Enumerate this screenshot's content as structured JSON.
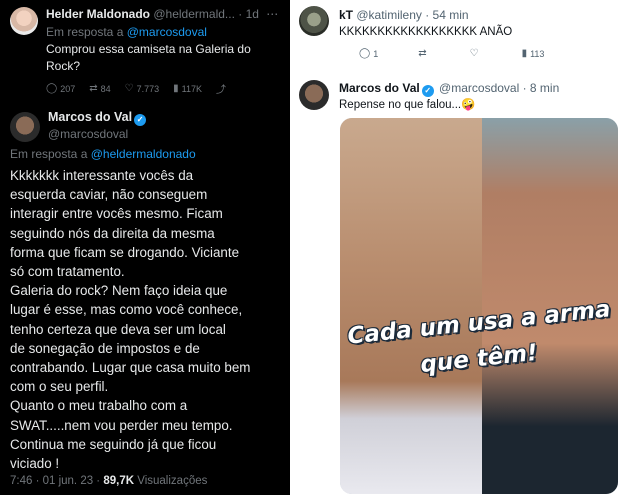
{
  "left": {
    "reply_tweet": {
      "name": "Helder Maldonado",
      "handle_time": "@heldermald... · 1d",
      "in_reply_prefix": "Em resposta a",
      "in_reply_handle": "@marcosdoval",
      "text_line1": "Comprou essa camiseta na Galeria do",
      "text_line2": "Rock?",
      "metrics": {
        "replies": "207",
        "retweets": "84",
        "likes": "7.773",
        "views": "117K"
      }
    },
    "main_tweet": {
      "name": "Marcos do Val",
      "handle": "@marcosdoval",
      "in_reply_prefix": "Em resposta a",
      "in_reply_handle": "@heldermaldonado",
      "lines": [
        "Kkkkkkk interessante vocês da",
        "esquerda caviar, não conseguem",
        "interagir entre vocês mesmo. Ficam",
        "seguindo nós da direita da mesma",
        "forma que ficam se drogando. Viciante",
        "só com tratamento.",
        "Galeria do rock? Nem faço ideia que",
        "lugar é esse, mas como você conhece,",
        "tenho certeza que deva ser um local",
        "de sonegação de impostos e de",
        "contrabando. Lugar que casa muito bem",
        "com o seu perfil.",
        "Quanto o meu trabalho com a",
        "SWAT.....nem vou perder meu tempo.",
        "Continua me seguindo já que ficou",
        "viciado !"
      ],
      "time_date": "7:46 · 01 jun. 23 ·",
      "views_count": "89,7K",
      "views_label": "Visualizações"
    }
  },
  "right": {
    "tweet1": {
      "name": "kT",
      "handle_time": "@katimileny · 54 min",
      "text": "KKKKKKKKKKKKKKKKKK ANÃO",
      "metrics": {
        "replies": "1",
        "views": "113"
      }
    },
    "tweet2": {
      "name": "Marcos do Val",
      "handle_time": "@marcosdoval · 8 min",
      "text": "Repense no que falou...🤪",
      "photo_text_line1": "Cada um usa a arma",
      "photo_text_line2": "que têm!"
    }
  }
}
